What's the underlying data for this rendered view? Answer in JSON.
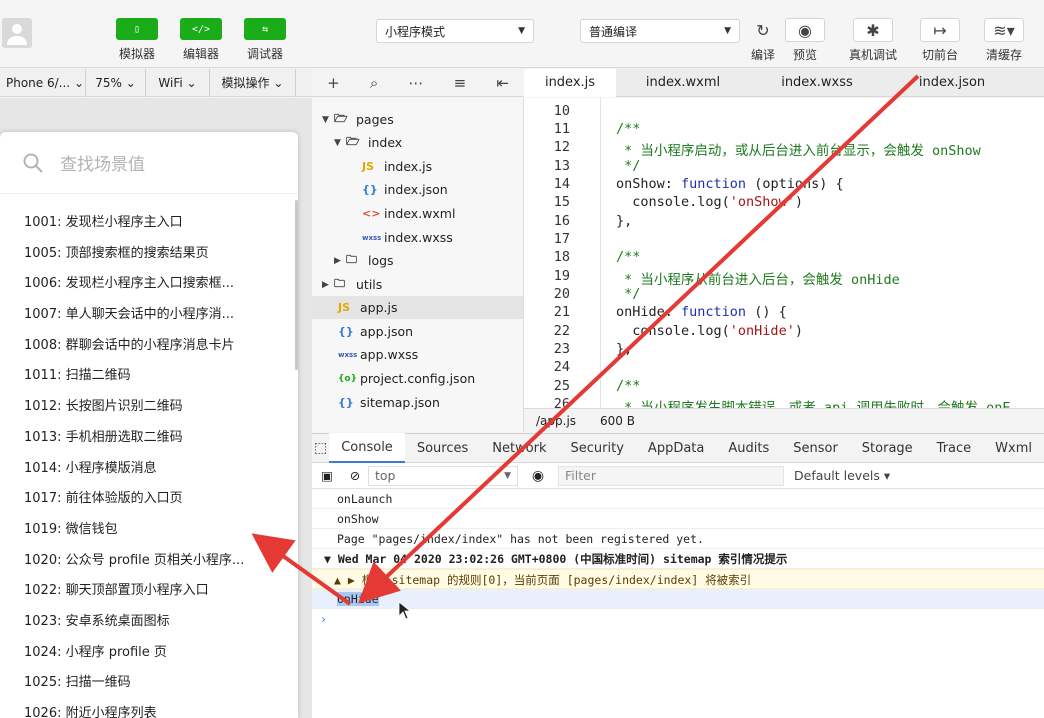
{
  "toolbar": {
    "simulator_label": "模拟器",
    "editor_label": "编辑器",
    "debugger_label": "调试器",
    "mode_select": "小程序模式",
    "compile_select": "普通编译",
    "compile_label": "编译",
    "preview_label": "预览",
    "real_debug_label": "真机调试",
    "switch_front_label": "切前台",
    "clear_cache_label": "清缓存"
  },
  "device": {
    "model": "Phone 6/...",
    "zoom": "75%",
    "network": "WiFi",
    "simulate_ops": "模拟操作"
  },
  "scene_panel": {
    "search_placeholder": "查找场景值",
    "items": [
      "1001: 发现栏小程序主入口",
      "1005: 顶部搜索框的搜索结果页",
      "1006: 发现栏小程序主入口搜索框...",
      "1007: 单人聊天会话中的小程序消...",
      "1008: 群聊会话中的小程序消息卡片",
      "1011: 扫描二维码",
      "1012: 长按图片识别二维码",
      "1013: 手机相册选取二维码",
      "1014: 小程序模版消息",
      "1017: 前往体验版的入口页",
      "1019: 微信钱包",
      "1020: 公众号 profile 页相关小程序...",
      "1022: 聊天顶部置顶小程序入口",
      "1023: 安卓系统桌面图标",
      "1024: 小程序 profile 页",
      "1025: 扫描一维码",
      "1026: 附近小程序列表"
    ]
  },
  "file_tree": {
    "pages": "pages",
    "index_dir": "index",
    "index_js": "index.js",
    "index_json": "index.json",
    "index_wxml": "index.wxml",
    "index_wxss": "index.wxss",
    "logs": "logs",
    "utils": "utils",
    "app_js": "app.js",
    "app_json": "app.json",
    "app_wxss": "app.wxss",
    "project_config": "project.config.json",
    "sitemap": "sitemap.json"
  },
  "editor": {
    "tabs": [
      "index.js",
      "index.wxml",
      "index.wxss",
      "index.json"
    ],
    "line_numbers": [
      "10",
      "11",
      "12",
      "13",
      "14",
      "15",
      "16",
      "17",
      "18",
      "19",
      "20",
      "21",
      "22",
      "23",
      "24",
      "25",
      "26"
    ],
    "lines": {
      "l11": "/**",
      "l12": " * 当小程序启动，或从后台进入前台显示，会触发 onShow",
      "l13": " */",
      "l14_a": "onShow: ",
      "l14_b": "function",
      "l14_c": " (options) {",
      "l15_a": "  console.log(",
      "l15_b": "'onShow'",
      "l15_c": ")",
      "l16": "},",
      "l18": "/**",
      "l19": " * 当小程序从前台进入后台，会触发 onHide",
      "l20": " */",
      "l21_a": "onHide: ",
      "l21_b": "function",
      "l21_c": " () {",
      "l22_a": "  console.log(",
      "l22_b": "'onHide'",
      "l22_c": ")",
      "l23": "},",
      "l25": "/**",
      "l26": " * 当小程序发生脚本错误，或者 api 调用失败时，会触发 onE"
    },
    "status_path": "/app.js",
    "status_size": "600 B"
  },
  "devtools": {
    "tabs": [
      "Console",
      "Sources",
      "Network",
      "Security",
      "AppData",
      "Audits",
      "Sensor",
      "Storage",
      "Trace",
      "Wxml"
    ],
    "context": "top",
    "filter_placeholder": "Filter",
    "levels": "Default levels ▾",
    "logs": [
      "onLaunch",
      "onShow",
      "Page \"pages/index/index\" has not been registered yet.",
      "▼ Wed Mar 04 2020 23:02:26 GMT+0800 (中国标准时间) sitemap 索引情况提示",
      "▲ ▶ 根据 sitemap 的规则[0]，当前页面 [pages/index/index] 将被索引",
      "onHide"
    ],
    "prompt": "›"
  },
  "colors": {
    "green": "#1aad19",
    "arrow": "#e53935",
    "accent": "#3a7bd5"
  }
}
